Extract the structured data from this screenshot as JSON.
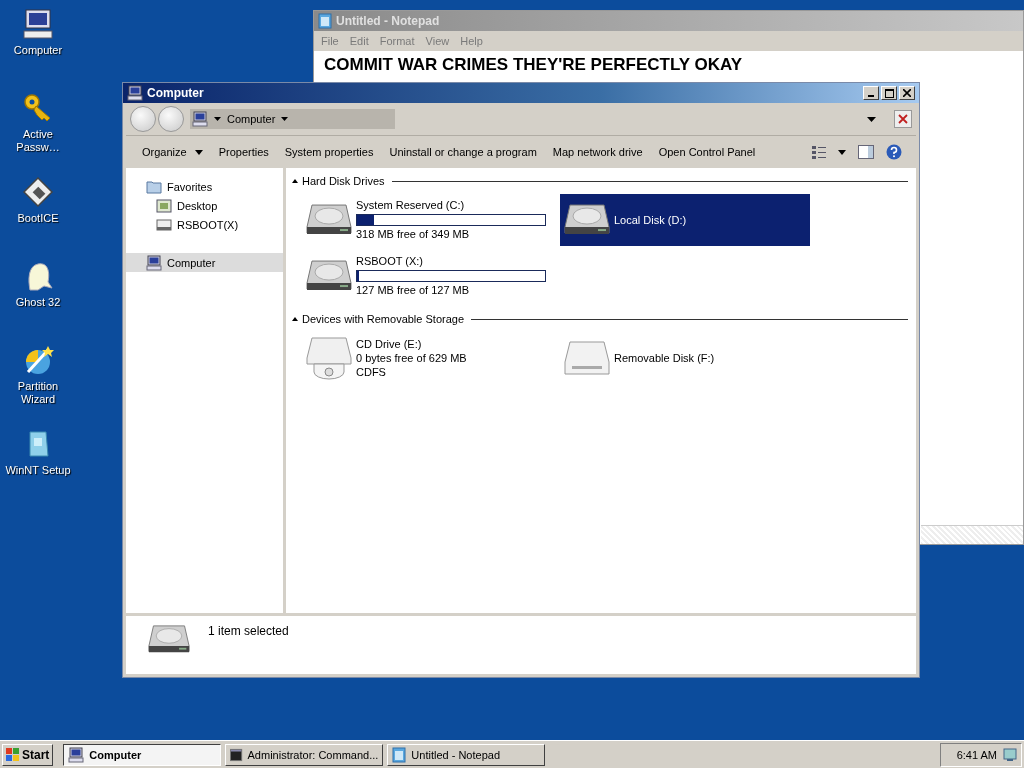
{
  "desktop_icons": [
    {
      "label": "Computer",
      "kind": "computer"
    },
    {
      "label": "Active Passw…",
      "kind": "key"
    },
    {
      "label": "BootICE",
      "kind": "bootice"
    },
    {
      "label": "Ghost 32",
      "kind": "ghost"
    },
    {
      "label": "Partition Wizard",
      "kind": "wizard"
    },
    {
      "label": "WinNT Setup",
      "kind": "setup"
    }
  ],
  "notepad": {
    "title": "Untitled - Notepad",
    "menu": [
      "File",
      "Edit",
      "Format",
      "View",
      "Help"
    ],
    "lines": [
      "COMMIT WAR CRIMES THEY'RE PERFECTLY OKAY"
    ]
  },
  "explorer": {
    "title": "Computer",
    "address": "Computer",
    "toolbar": [
      {
        "label": "Organize",
        "dropdown": true
      },
      {
        "label": "Properties",
        "dropdown": false
      },
      {
        "label": "System properties",
        "dropdown": false
      },
      {
        "label": "Uninstall or change a program",
        "dropdown": false
      },
      {
        "label": "Map network drive",
        "dropdown": false
      },
      {
        "label": "Open Control Panel",
        "dropdown": false
      }
    ],
    "nav": [
      {
        "label": "Favorites",
        "kind": "folder",
        "selected": false,
        "children": [
          {
            "label": "Desktop",
            "kind": "desktop",
            "selected": false
          },
          {
            "label": "RSBOOT(X)",
            "kind": "drive",
            "selected": false
          }
        ]
      },
      {
        "label": "Computer",
        "kind": "computer",
        "selected": true
      }
    ],
    "groups": [
      {
        "title": "Hard Disk Drives",
        "items": [
          {
            "name": "System Reserved (C:)",
            "kind": "hdd",
            "level": 0.09,
            "details": [
              "318 MB free of 349 MB"
            ],
            "selected": false
          },
          {
            "name": "Local Disk (D:)",
            "kind": "hdd",
            "selected": true
          },
          {
            "name": "RSBOOT (X:)",
            "kind": "hdd",
            "level": 0.01,
            "details": [
              "127 MB free of 127 MB"
            ],
            "selected": false
          }
        ]
      },
      {
        "title": "Devices with Removable Storage",
        "items": [
          {
            "name": "CD Drive (E:)",
            "kind": "cd",
            "details": [
              "0 bytes free of 629 MB",
              "CDFS"
            ],
            "selected": false
          },
          {
            "name": "Removable Disk (F:)",
            "kind": "removable",
            "selected": false
          }
        ]
      }
    ],
    "status": "1 item selected"
  },
  "taskbar": {
    "start": "Start",
    "tasks": [
      {
        "label": "Computer",
        "kind": "computer",
        "selected": true
      },
      {
        "label": "Administrator: Command...",
        "kind": "console",
        "selected": false
      },
      {
        "label": "Untitled - Notepad",
        "kind": "notepad",
        "selected": false
      }
    ],
    "clock": "6:41 AM"
  }
}
